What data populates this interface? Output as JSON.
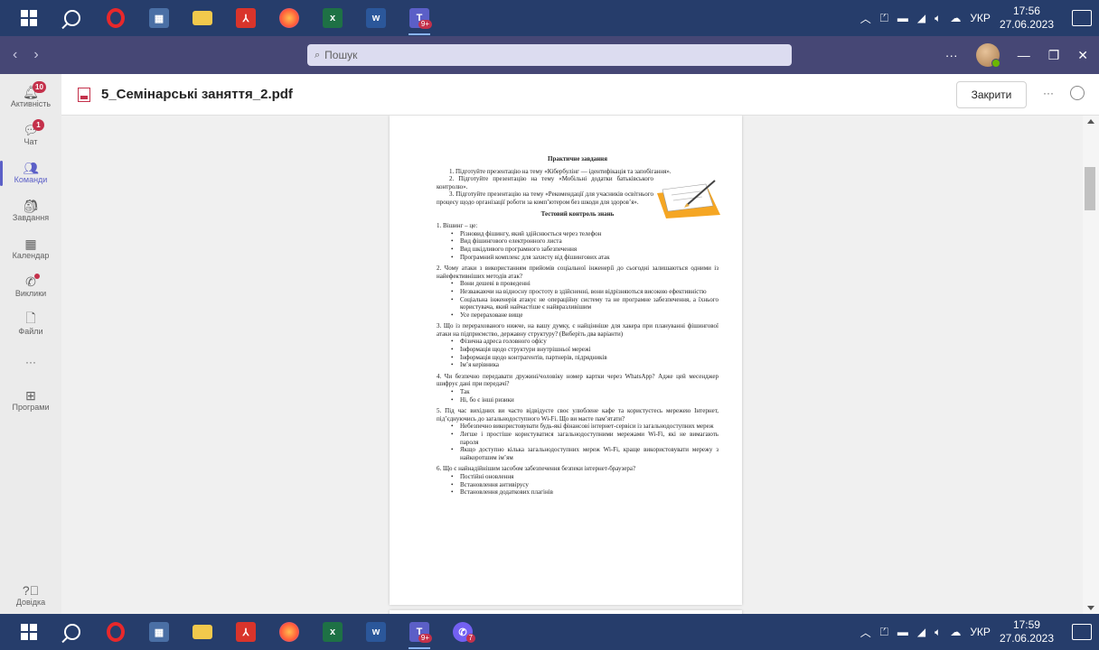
{
  "taskbar_top": {
    "apps": [
      "start",
      "search",
      "opera",
      "calculator",
      "file-explorer",
      "acrobat",
      "firefox",
      "excel",
      "word",
      "teams"
    ],
    "teams_badge": "9+",
    "lang": "УКР",
    "time": "17:56",
    "date": "27.06.2023"
  },
  "taskbar_bottom": {
    "teams_badge": "9+",
    "viber_badge": "7",
    "lang": "УКР",
    "time": "17:59",
    "date": "27.06.2023"
  },
  "titlebar": {
    "back": "‹",
    "forward": "›",
    "search_placeholder": "Пошук",
    "more": "···",
    "minimize": "—",
    "maximize": "❐",
    "close": "✕"
  },
  "rail": {
    "items": [
      {
        "label": "Активність",
        "icon": "bell-icon",
        "badge": "10"
      },
      {
        "label": "Чат",
        "icon": "chat-icon",
        "badge": "1"
      },
      {
        "label": "Команди",
        "icon": "teams-icon",
        "active": true
      },
      {
        "label": "Завдання",
        "icon": "assignments-icon"
      },
      {
        "label": "Календар",
        "icon": "calendar-icon"
      },
      {
        "label": "Виклики",
        "icon": "phone-icon"
      },
      {
        "label": "Файли",
        "icon": "file-icon"
      },
      {
        "label": "···",
        "icon": "more-icon"
      },
      {
        "label": "Програми",
        "icon": "apps-icon"
      }
    ],
    "help_label": "Довідка"
  },
  "file_header": {
    "title": "5_Семінарські заняття_2.pdf",
    "close_label": "Закрити",
    "more": "···"
  },
  "document": {
    "heading1": "Практичне завдання",
    "tasks": [
      "1.   Підготуйте презентацію на тему «Кібербулінг — ідентифікація та запобігання».",
      "2.   Підготуйте презентацію на тему «Мобільні додатки батьківського контролю».",
      "3.   Підготуйте презентацію на тему «Рекомендації для учасників освітнього процесу щодо організації роботи за комп’ютером без шкоди для здоров’я»."
    ],
    "heading2": "Тестовий контроль знань",
    "questions": [
      {
        "q": "1. Вішинг – це:",
        "options": [
          "Різновид фішингу, який здійснюється через телефон",
          "Вид фішингового електронного листа",
          "Вид шкідливого програмного забезпечення",
          "Програмний комплекс для захисту від фішингових атак"
        ]
      },
      {
        "q": "2. Чому атаки з використанням прийомів соціальної інженерії до сьогодні залишаються одними із найефективніших методів атак?",
        "options": [
          "Вони дешеві в проведенні",
          "Незважаючи на відносну простоту в здійсненні, вони відрізняються високою ефективністю",
          "Соціальна інженерія атакує не операційну систему та не програмне забезпечення, а їхнього користувача, який найчастіше є найвразливішим",
          "Усе перераховане вище"
        ]
      },
      {
        "q": "3. Що із перерахованого нижче, на вашу думку, є найцінніше для хакера при плануванні фішингової атаки на підприємство, державну структуру? (Виберіть два варіанти)",
        "options": [
          "Фізична адреса головного офісу",
          "Інформація щодо структури внутрішньої мережі",
          "Інформація щодо контрагентів, партнерів, підрядників",
          "Ім’я керівника"
        ]
      },
      {
        "q": "4. Чи безпечно передавати дружині/чоловіку номер картки через WhatsApp? Адже цей месенджер шифрує дані при передачі?",
        "options": [
          "Так",
          "Ні, бо є інші ризики"
        ]
      },
      {
        "q": "5. Під час вихідних ви часто відвідуєте своє улюблене кафе та користуєтесь мережею Інтернет, під’єднуючись до загальнодоступного Wi-Fi. Що ви маєте пам’ятати?",
        "options": [
          "Небезпечно використовувати будь-які фінансові інтернет-сервіси із загальнодоступних мереж",
          "Легше і простіше користуватися загальнодоступними мережами Wi-Fi, які не вимагають пароля",
          "Якщо доступно кілька загальнодоступних мереж Wi-Fi, краще використовувати мережу з найкоротшим ім’ям"
        ]
      },
      {
        "q": "6. Що є найнадійнішим засобом забезпечення безпеки інтернет-браузера?",
        "options": [
          "Постійні оновлення",
          "Встановлення антивірусу",
          "Встановлення додаткових плагінів"
        ]
      }
    ]
  },
  "colors": {
    "taskbar": "#263d6b",
    "teams_titlebar": "#464775",
    "accent": "#5b5fc7",
    "badge": "#c4314b"
  }
}
